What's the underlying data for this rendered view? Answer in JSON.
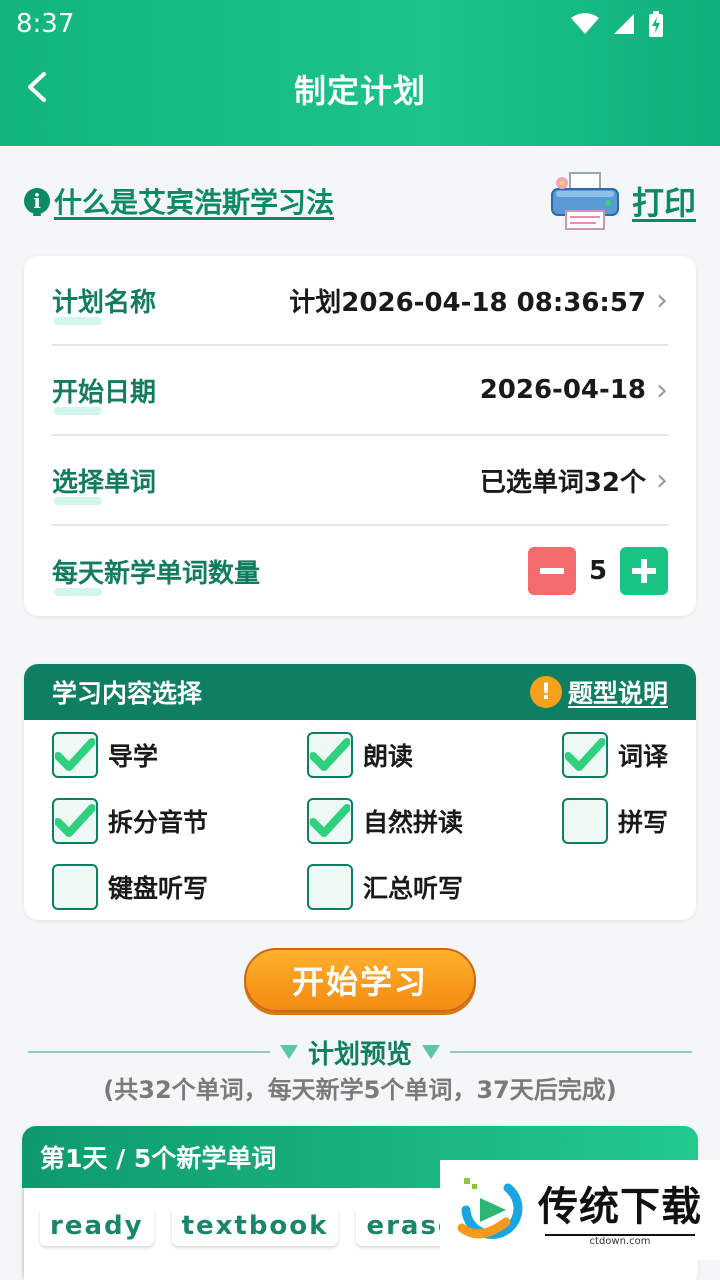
{
  "status": {
    "time": "8:37"
  },
  "header": {
    "title": "制定计划"
  },
  "info_link": {
    "icon": "i",
    "label": "什么是艾宾浩斯学习法"
  },
  "print": {
    "label": "打印"
  },
  "plan": {
    "rows": [
      {
        "label": "计划名称",
        "value": "计划2026-04-18 08:36:57"
      },
      {
        "label": "开始日期",
        "value": "2026-04-18"
      },
      {
        "label": "选择单词",
        "value": "已选单词32个"
      }
    ],
    "daily_label": "每天新学单词数量",
    "daily_count": "5"
  },
  "content": {
    "title": "学习内容选择",
    "help_icon": "!",
    "help_label": "题型说明",
    "options": [
      {
        "label": "导学",
        "checked": true
      },
      {
        "label": "朗读",
        "checked": true
      },
      {
        "label": "词译",
        "checked": true
      },
      {
        "label": "拆分音节",
        "checked": true
      },
      {
        "label": "自然拼读",
        "checked": true
      },
      {
        "label": "拼写",
        "checked": false
      },
      {
        "label": "键盘听写",
        "checked": false
      },
      {
        "label": "汇总听写",
        "checked": false
      }
    ]
  },
  "start_button": "开始学习",
  "preview": {
    "title": "计划预览",
    "subtitle": "(共32个单词，每天新学5个单词，37天后完成)",
    "day1": {
      "title": "第1天 / 5个新学单词",
      "words": [
        "ready",
        "textbook",
        "eraser"
      ]
    }
  },
  "watermark": {
    "main": "传统下载",
    "sub": "ctdown.com"
  },
  "colors": {
    "primary": "#12b67a",
    "dark_green": "#0e7f62",
    "orange": "#f38b12",
    "minus_red": "#f36b6b"
  }
}
